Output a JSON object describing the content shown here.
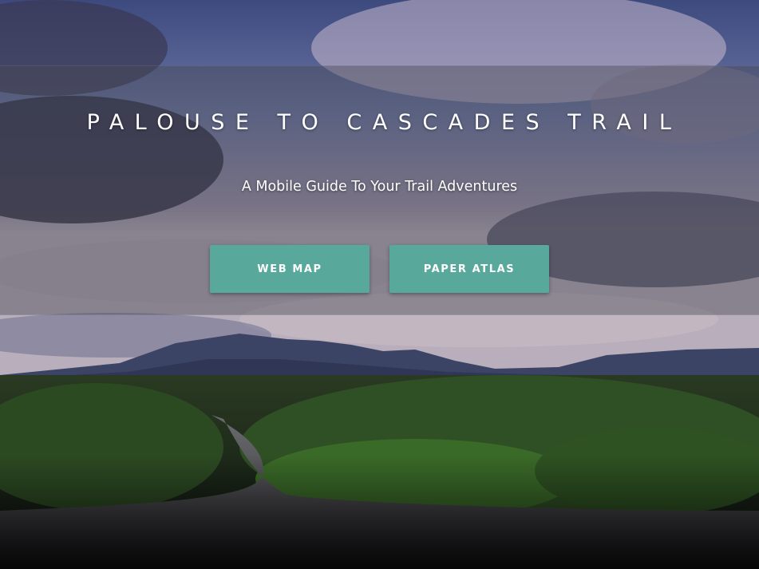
{
  "hero": {
    "title": "PALOUSE TO CASCADES TRAIL",
    "subtitle": "A Mobile Guide To Your Trail Adventures",
    "background_image": "mountain-road-landscape"
  },
  "buttons": {
    "web_map_label": "WEB MAP",
    "paper_atlas_label": "PAPER ATLAS"
  },
  "colors": {
    "button_bg": "#58a89c",
    "banner_overlay": "#464852"
  }
}
